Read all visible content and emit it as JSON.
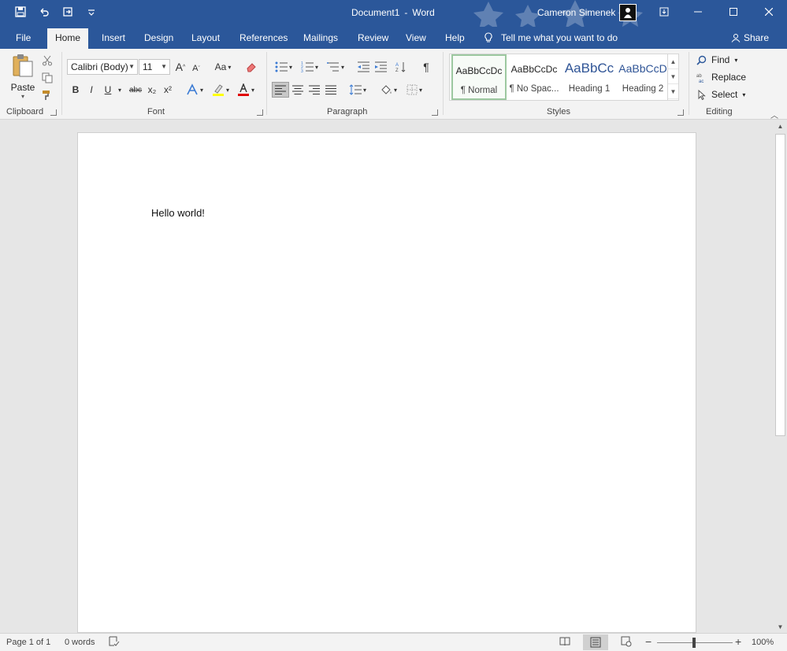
{
  "titlebar": {
    "doc_name": "Document1",
    "separator": "-",
    "app_name": "Word",
    "user_name": "Cameron Simenek"
  },
  "tabs": [
    "File",
    "Home",
    "Insert",
    "Design",
    "Layout",
    "References",
    "Mailings",
    "Review",
    "View",
    "Help"
  ],
  "active_tab": "Home",
  "tell_me": "Tell me what you want to do",
  "share_label": "Share",
  "clipboard": {
    "paste_label": "Paste",
    "group_label": "Clipboard"
  },
  "font": {
    "font_name": "Calibri (Body)",
    "font_size": "11",
    "grow": "A",
    "shrink": "A",
    "change_case": "Aa",
    "bold": "B",
    "italic": "I",
    "underline": "U",
    "strike": "abc",
    "subscript": "x₂",
    "superscript": "x²",
    "group_label": "Font"
  },
  "paragraph": {
    "group_label": "Paragraph"
  },
  "styles": {
    "items": [
      {
        "sample": "AaBbCcDc",
        "name": "¶ Normal"
      },
      {
        "sample": "AaBbCcDc",
        "name": "¶ No Spac..."
      },
      {
        "sample": "AaBbCc",
        "name": "Heading 1"
      },
      {
        "sample": "AaBbCcD",
        "name": "Heading 2"
      }
    ],
    "group_label": "Styles"
  },
  "editing": {
    "find": "Find",
    "replace": "Replace",
    "select": "Select",
    "group_label": "Editing"
  },
  "document": {
    "text": "Hello world!"
  },
  "status": {
    "page": "Page 1 of 1",
    "words": "0 words",
    "zoom": "100%",
    "zoom_level_percent": 100
  },
  "colors": {
    "brand": "#2b579a",
    "ribbon": "#f3f3f3",
    "canvas": "#e6e6e6",
    "font_color_bar": "#e00000",
    "highlight_bar": "#ffff00"
  }
}
